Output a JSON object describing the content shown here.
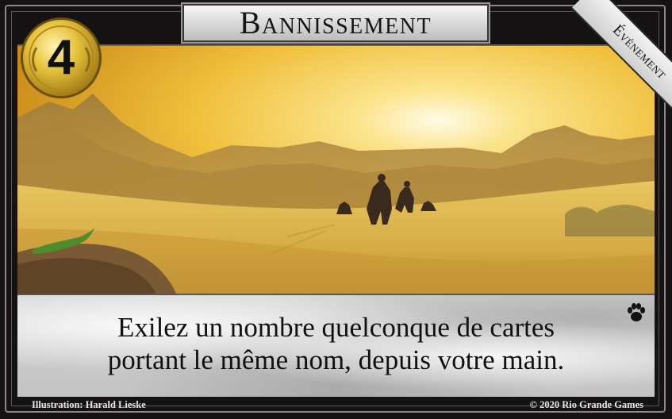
{
  "card": {
    "name": "Bannissement",
    "cost": "4",
    "type": "Événement",
    "text_lines": [
      "Exilez un nombre quelconque de cartes",
      "portant le même nom, depuis votre main."
    ],
    "set_icon": "paw-icon",
    "illustration_credit": "Illustration: Harald Lieske",
    "copyright": "© 2020 Rio Grande Games"
  },
  "colors": {
    "frame": "#141212",
    "coin_gold": "#e3bf3a",
    "sky": "#f2c44a",
    "sand": "#d9b249"
  }
}
